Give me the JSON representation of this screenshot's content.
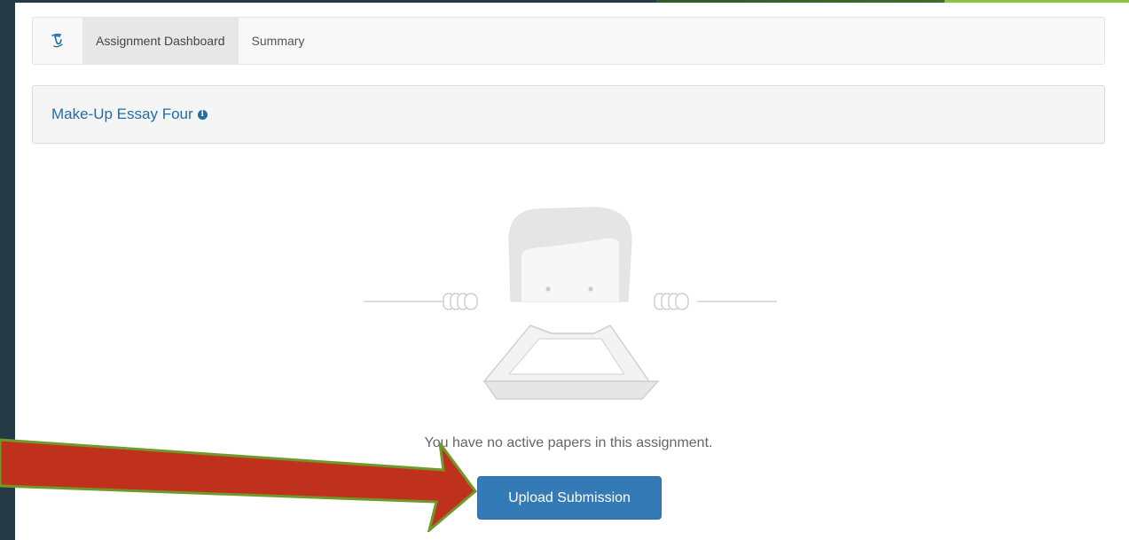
{
  "nav": {
    "logo_icon": "turnitin-logo-icon",
    "tabs": [
      {
        "label": "Assignment Dashboard",
        "active": true
      },
      {
        "label": "Summary",
        "active": false
      }
    ]
  },
  "assignment": {
    "title": "Make-Up Essay Four",
    "info_icon": "info-icon",
    "info_glyph": "i"
  },
  "empty_state": {
    "illustration": "person-peeking-over-empty-tray",
    "message": "You have no active papers in this assignment."
  },
  "actions": {
    "upload_label": "Upload Submission"
  },
  "annotation": {
    "arrow_icon": "red-arrow-pointing-right"
  },
  "colors": {
    "accent_blue": "#337ab7",
    "title_blue": "#1f6fa5",
    "arrow_red": "#c0311d",
    "arrow_outline": "#6f9a2b",
    "frame_dark": "#243a45",
    "frame_green": "#8cc63f"
  }
}
